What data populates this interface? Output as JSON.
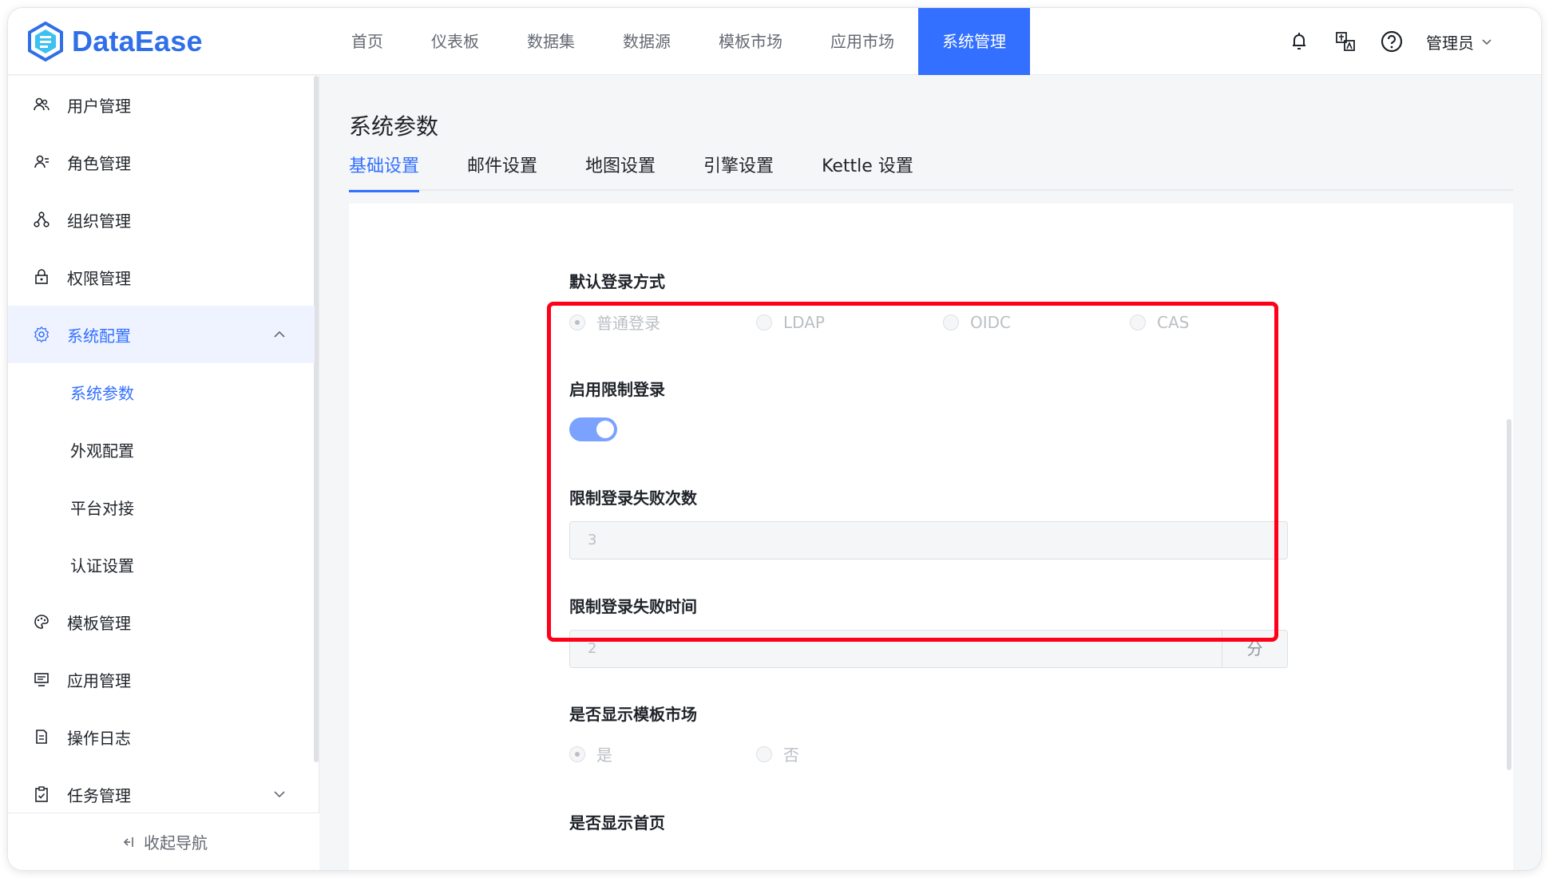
{
  "app": {
    "brand": "DataEase"
  },
  "nav": [
    "首页",
    "仪表板",
    "数据集",
    "数据源",
    "模板市场",
    "应用市场",
    "系统管理"
  ],
  "nav_active": "系统管理",
  "header": {
    "user": "管理员"
  },
  "sidebar": {
    "items": [
      {
        "label": "用户管理",
        "icon": "users-icon"
      },
      {
        "label": "角色管理",
        "icon": "role-icon"
      },
      {
        "label": "组织管理",
        "icon": "org-icon"
      },
      {
        "label": "权限管理",
        "icon": "lock-icon"
      },
      {
        "label": "系统配置",
        "icon": "gear-icon"
      },
      {
        "label": "模板管理",
        "icon": "palette-icon"
      },
      {
        "label": "应用管理",
        "icon": "monitor-icon"
      },
      {
        "label": "操作日志",
        "icon": "document-icon"
      },
      {
        "label": "任务管理",
        "icon": "clipboard-icon"
      }
    ],
    "sub_items": [
      "系统参数",
      "外观配置",
      "平台对接",
      "认证设置"
    ],
    "collapse_label": "收起导航"
  },
  "main": {
    "title": "系统参数",
    "tabs": [
      "基础设置",
      "邮件设置",
      "地图设置",
      "引擎设置",
      "Kettle 设置"
    ],
    "active_tab": "基础设置",
    "form": {
      "login_method_label": "默认登录方式",
      "login_methods": [
        "普通登录",
        "LDAP",
        "OIDC",
        "CAS"
      ],
      "login_method_selected": "普通登录",
      "limit_login_label": "启用限制登录",
      "limit_login_enabled": true,
      "fail_count_label": "限制登录失败次数",
      "fail_count_value": "3",
      "fail_time_label": "限制登录失败时间",
      "fail_time_value": "2",
      "fail_time_unit": "分",
      "show_template_market_label": "是否显示模板市场",
      "yes_no": [
        "是",
        "否"
      ],
      "show_template_market_selected": "是",
      "show_home_label": "是否显示首页"
    }
  },
  "colors": {
    "primary": "#3370ff",
    "highlight": "#ff0018",
    "toggle": "#7ba2ff"
  }
}
